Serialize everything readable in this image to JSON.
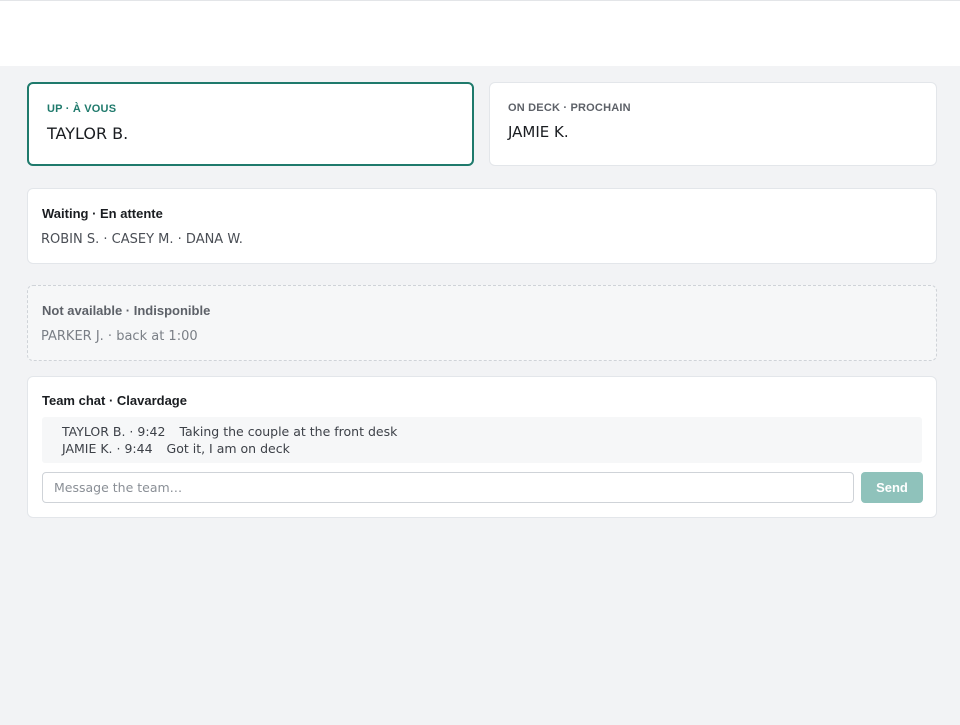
{
  "queue": {
    "up": {
      "label": "UP · À VOUS",
      "name": "TAYLOR B."
    },
    "on_deck": {
      "label": "ON DECK · PROCHAIN",
      "name": "JAMIE K."
    }
  },
  "waiting": {
    "title": "Waiting · En attente",
    "list": "ROBIN S. · CASEY M. · DANA W."
  },
  "not_available": {
    "title": "Not available · Indisponible",
    "list": "PARKER J. · back at 1:00"
  },
  "chat": {
    "title": "Team chat · Clavardage",
    "messages": [
      {
        "author_time": "TAYLOR B. · 9:42",
        "text": "Taking the couple at the front desk"
      },
      {
        "author_time": "JAMIE K. · 9:44",
        "text": "Got it, I am on deck"
      }
    ],
    "input_placeholder": "Message the team…",
    "input_value": "",
    "send_label": "Send"
  },
  "colors": {
    "accent": "#1f7a6c",
    "send_button": "#8fc2bb",
    "background": "#f2f3f5"
  }
}
